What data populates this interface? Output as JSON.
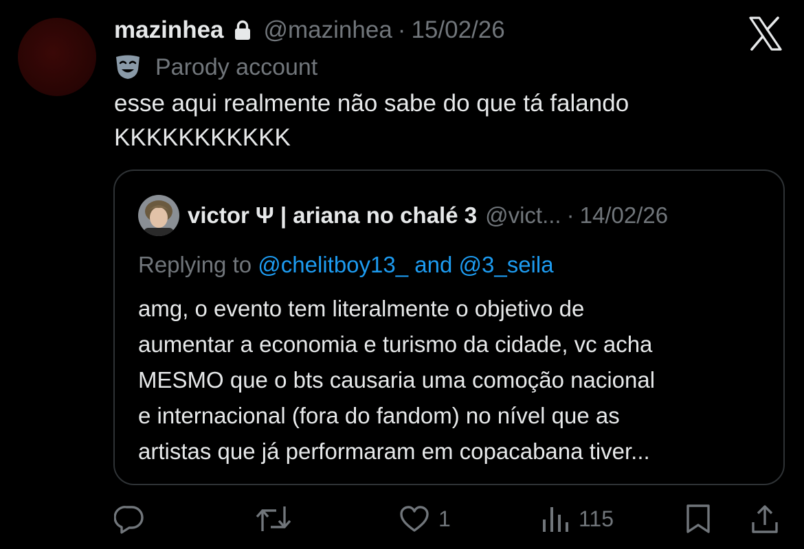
{
  "tweet": {
    "display_name": "mazinhea",
    "handle": "@mazinhea",
    "separator": "·",
    "date": "15/02/26",
    "parody_label": "Parody account",
    "text": "esse aqui realmente não sabe do que tá falando\nKKKKKKKKKKK"
  },
  "quote": {
    "display_name": "victor Ψ | ariana no chalé 3",
    "handle": "@vict...",
    "separator": "·",
    "date": "14/02/26",
    "replying_prefix": "Replying to",
    "mention_1": "@chelitboy13_",
    "connector": "and",
    "mention_2": "@3_seila",
    "text": "amg, o evento tem literalmente o objetivo de\naumentar a economia e turismo da cidade, vc acha\nMESMO que o bts causaria uma comoção nacional\ne internacional (fora do fandom) no nível que as\nartistas que já performaram em copacabana tiver..."
  },
  "actions": {
    "reply_icon": "reply-icon",
    "retweet_icon": "retweet-icon",
    "like_icon": "heart-icon",
    "like_count": "1",
    "views_icon": "views-icon",
    "views_count": "115",
    "bookmark_icon": "bookmark-icon",
    "share_icon": "share-icon"
  },
  "icons": {
    "brand": "x-logo",
    "lock": "lock-icon",
    "parody": "theater-mask-icon"
  },
  "colors": {
    "background": "#000000",
    "text": "#e7e9ea",
    "muted": "#71767b",
    "link": "#1d9bf0",
    "border": "#2f3336"
  }
}
